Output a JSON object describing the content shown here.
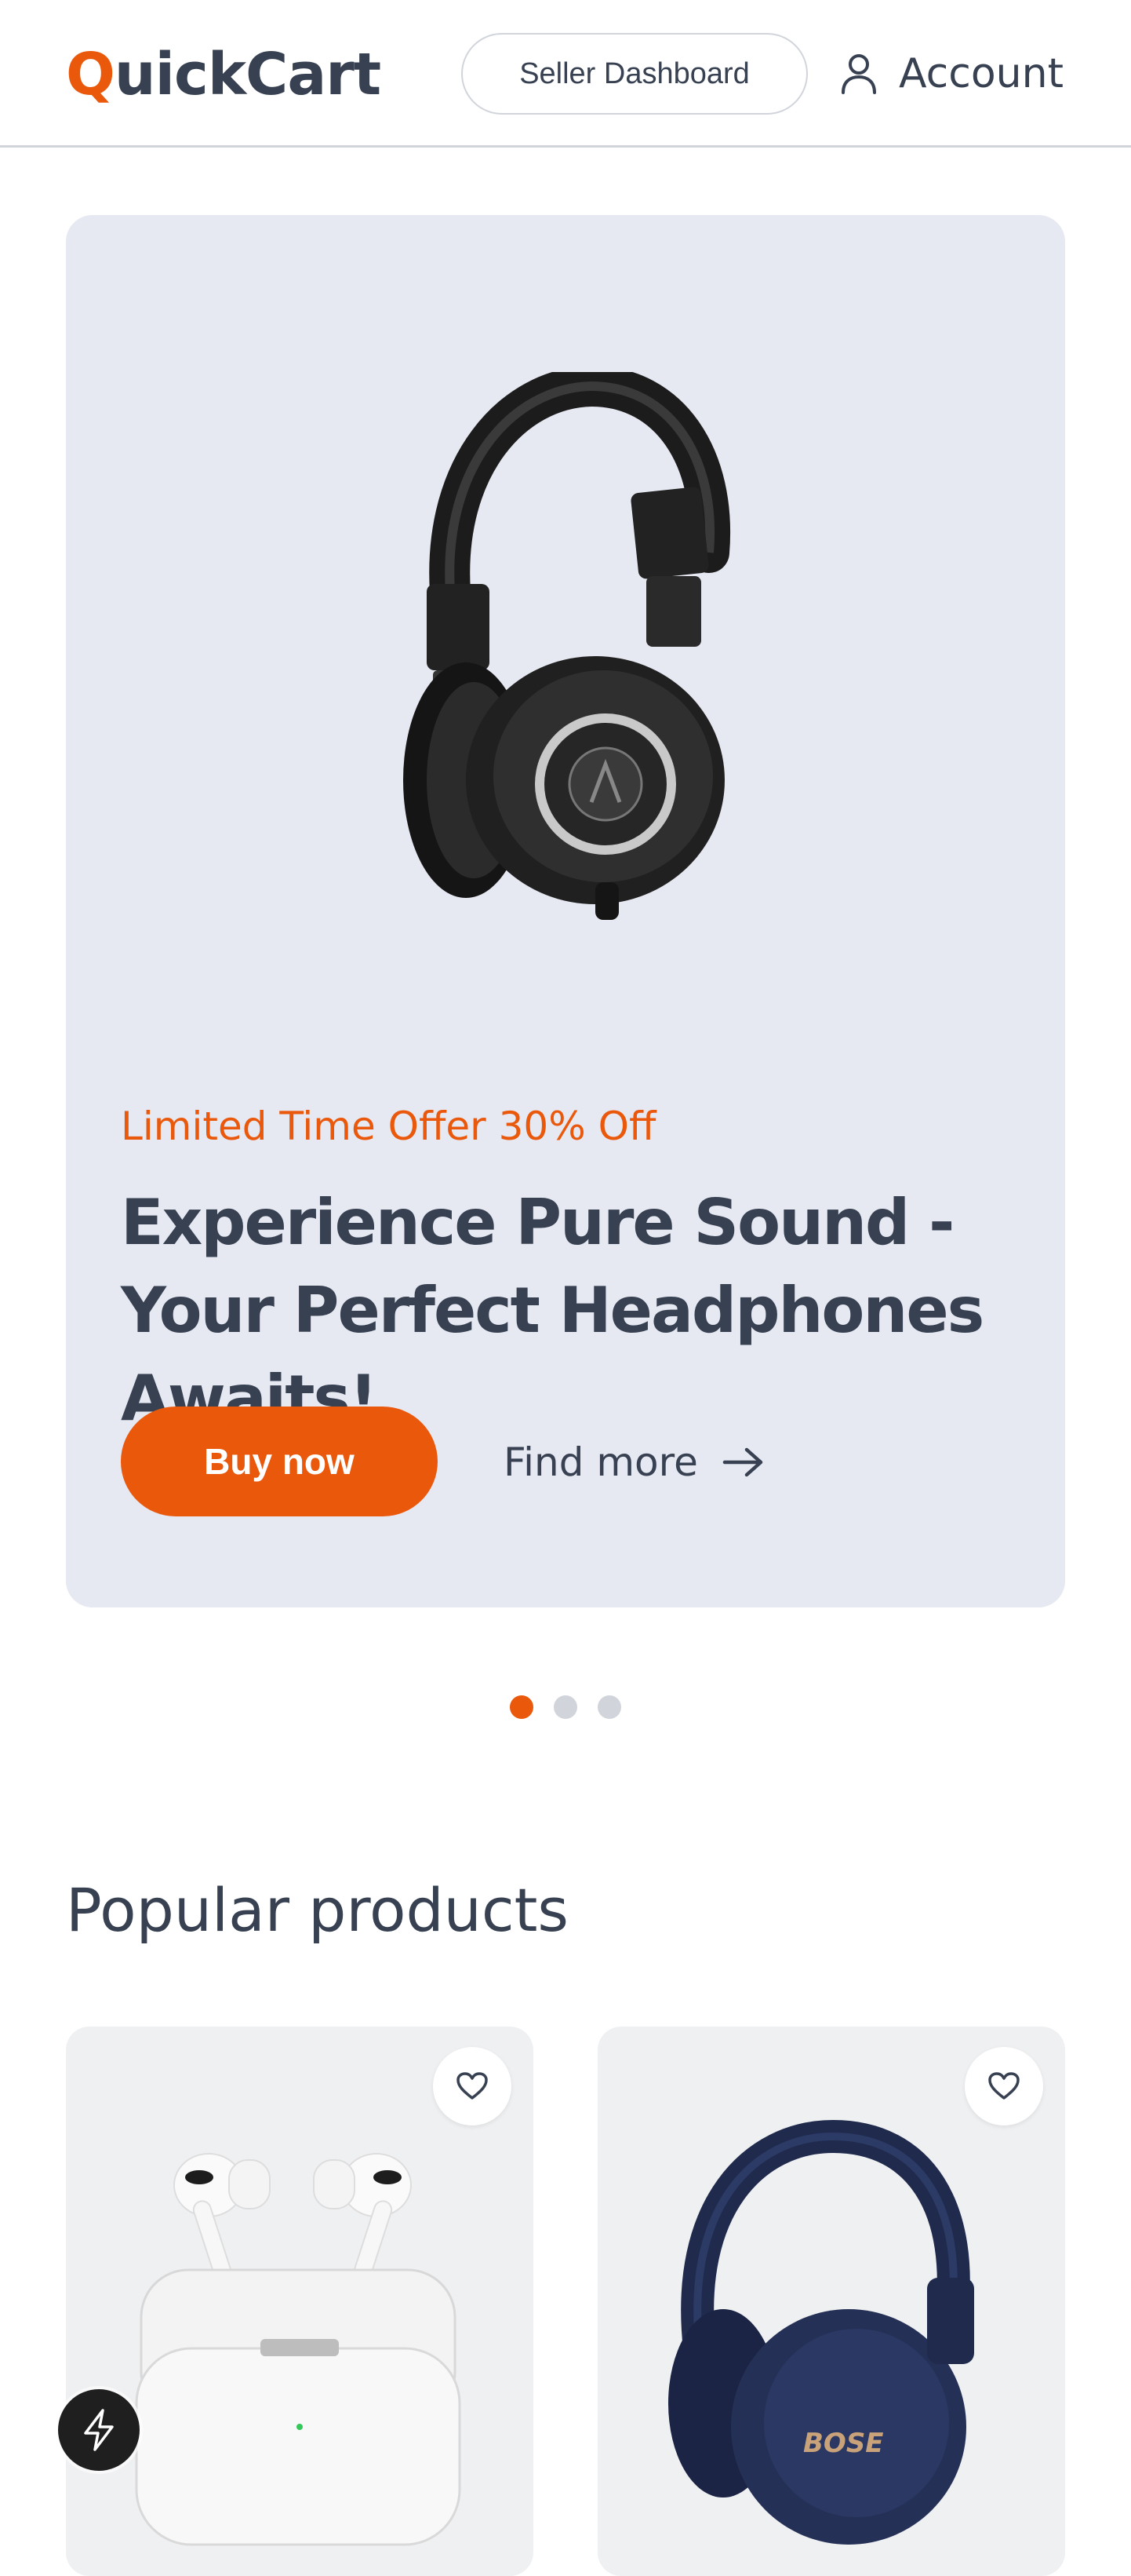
{
  "header": {
    "logo_first": "Q",
    "logo_rest": "uickCart",
    "seller_label": "Seller Dashboard",
    "account_label": "Account"
  },
  "hero": {
    "offer": "Limited Time Offer 30% Off",
    "headline": "Experience Pure Sound - Your Perfect Headphones Awaits!",
    "buy_label": "Buy now",
    "find_label": "Find more",
    "slides_total": 3,
    "active_slide": 1
  },
  "popular": {
    "title": "Popular products",
    "products": [
      {
        "image": "airpods-pro-case"
      },
      {
        "image": "bose-headphones-navy"
      }
    ]
  },
  "colors": {
    "accent": "#ea580c",
    "text": "#374151",
    "hero_bg": "#e6e8f2",
    "card_bg": "#eff0f2"
  },
  "icons": [
    "user-icon",
    "arrow-right-icon",
    "heart-icon",
    "bolt-icon"
  ]
}
